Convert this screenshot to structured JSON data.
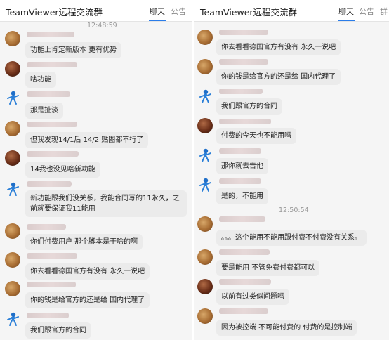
{
  "colors": {
    "accent": "#2b7de9",
    "bubble": "#ebebeb",
    "panel_bg": "#f5f5f5"
  },
  "left": {
    "window_title": "TeamViewer远程交流群",
    "tabs": [
      {
        "label": "聊天",
        "active": true
      },
      {
        "label": "公告",
        "active": false
      }
    ],
    "timestamp": "12:48:59",
    "messages": [
      {
        "avatar": "dog-avatar",
        "text": "功能上肯定新版本 更有优势"
      },
      {
        "avatar": "dark-avatar",
        "text": "啥功能"
      },
      {
        "avatar": "teamviewer-avatar",
        "text": "那是扯淡"
      },
      {
        "avatar": "dog-avatar",
        "text": "但我发现14/1后  14/2 贴图都不行了"
      },
      {
        "avatar": "dark-avatar",
        "text": "14我也没见啥新功能"
      },
      {
        "avatar": "teamviewer-avatar",
        "text": "新功能跟我们没关系，我能合同写的11永久，之前就要保证我11能用"
      },
      {
        "avatar": "dog-avatar",
        "text": "你们付费用户 那个脚本是干啥的啊"
      },
      {
        "avatar": "dog-avatar",
        "text": "你去看看德国官方有没有 永久一说吧"
      },
      {
        "avatar": "dog-avatar",
        "text": "你的钱是给官方的还是给 国内代理了"
      },
      {
        "avatar": "teamviewer-avatar",
        "text": "我们跟官方的合同"
      }
    ]
  },
  "right": {
    "window_title": "TeamViewer远程交流群",
    "tabs": [
      {
        "label": "聊天",
        "active": true
      },
      {
        "label": "公告",
        "active": false
      },
      {
        "label": "群",
        "active": false
      }
    ],
    "timestamp": "12:50:54",
    "messages": [
      {
        "avatar": "dog-avatar",
        "text": "你去看看德国官方有没有 永久一说吧"
      },
      {
        "avatar": "dog-avatar",
        "text": "你的钱是给官方的还是给 国内代理了"
      },
      {
        "avatar": "teamviewer-avatar",
        "text": "我们跟官方的合同"
      },
      {
        "avatar": "dark-avatar",
        "text": "付费的今天也不能用吗"
      },
      {
        "avatar": "teamviewer-avatar",
        "text": "那你就去告他"
      },
      {
        "avatar": "teamviewer-avatar",
        "text": "是的，不能用"
      },
      {
        "avatar": "dog-avatar",
        "text": "。。。这个能用不能用跟付费不付费没有关系。"
      },
      {
        "avatar": "dog-avatar",
        "text": "要是能用 不管免费付费都可以"
      },
      {
        "avatar": "dark-avatar",
        "text": "以前有过类似问题吗"
      },
      {
        "avatar": "dog-avatar",
        "text": "因为被控端 不可能付费的   付费的是控制端"
      }
    ]
  }
}
